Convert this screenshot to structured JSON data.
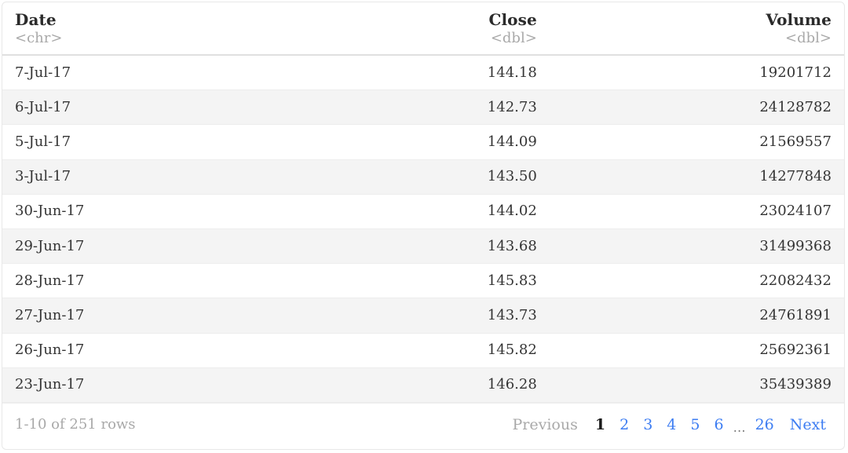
{
  "table": {
    "columns": [
      {
        "name": "Date",
        "type": "<chr>",
        "align": "left"
      },
      {
        "name": "Close",
        "type": "<dbl>",
        "align": "right"
      },
      {
        "name": "Volume",
        "type": "<dbl>",
        "align": "right"
      }
    ],
    "rows": [
      {
        "date": "7-Jul-17",
        "close": "144.18",
        "volume": "19201712"
      },
      {
        "date": "6-Jul-17",
        "close": "142.73",
        "volume": "24128782"
      },
      {
        "date": "5-Jul-17",
        "close": "144.09",
        "volume": "21569557"
      },
      {
        "date": "3-Jul-17",
        "close": "143.50",
        "volume": "14277848"
      },
      {
        "date": "30-Jun-17",
        "close": "144.02",
        "volume": "23024107"
      },
      {
        "date": "29-Jun-17",
        "close": "143.68",
        "volume": "31499368"
      },
      {
        "date": "28-Jun-17",
        "close": "145.83",
        "volume": "22082432"
      },
      {
        "date": "27-Jun-17",
        "close": "143.73",
        "volume": "24761891"
      },
      {
        "date": "26-Jun-17",
        "close": "145.82",
        "volume": "25692361"
      },
      {
        "date": "23-Jun-17",
        "close": "146.28",
        "volume": "35439389"
      }
    ]
  },
  "footer": {
    "page_info": "1-10 of 251 rows",
    "previous_label": "Previous",
    "next_label": "Next",
    "ellipsis": "…",
    "pages": [
      {
        "label": "1",
        "current": true
      },
      {
        "label": "2",
        "current": false
      },
      {
        "label": "3",
        "current": false
      },
      {
        "label": "4",
        "current": false
      },
      {
        "label": "5",
        "current": false
      },
      {
        "label": "6",
        "current": false
      },
      {
        "label": "26",
        "current": false
      }
    ]
  },
  "colors": {
    "link": "#3d7df2",
    "muted": "#a9a9a9",
    "text": "#343434",
    "header_text": "#2b2b2b",
    "stripe": "#f4f4f4",
    "border": "#e8e8e8"
  }
}
